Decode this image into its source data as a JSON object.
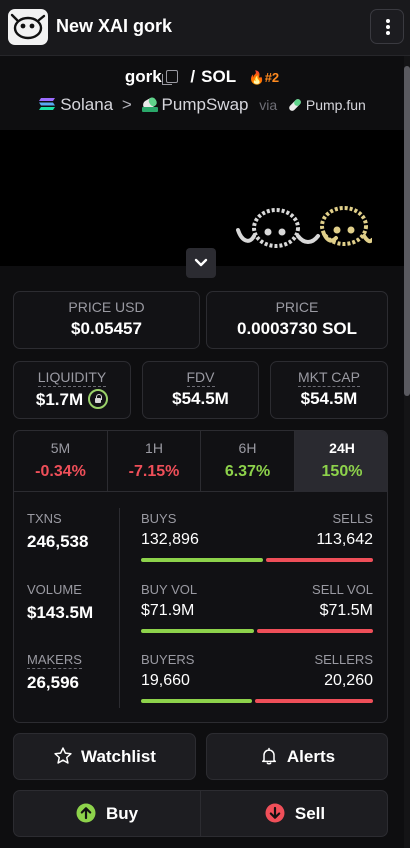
{
  "header": {
    "title": "New XAI gork",
    "logo_icon": "gork-face-icon",
    "menu_icon": "more-vertical-icon"
  },
  "pair": {
    "base": "gork",
    "separator": "/",
    "quote": "SOL",
    "rank": "#2"
  },
  "breadcrumb": {
    "chain": "Solana",
    "dex": "PumpSwap",
    "via": "via",
    "source": "Pump.fun"
  },
  "price": {
    "usd_label": "PRICE USD",
    "usd_value": "$0.05457",
    "native_label": "PRICE",
    "native_value": "0.0003730 SOL"
  },
  "metrics": {
    "liquidity_label": "LIQUIDITY",
    "liquidity_value": "$1.7M",
    "fdv_label": "FDV",
    "fdv_value": "$54.5M",
    "mcap_label": "MKT CAP",
    "mcap_value": "$54.5M"
  },
  "timeframes": [
    {
      "label": "5M",
      "change": "-0.34%"
    },
    {
      "label": "1H",
      "change": "-7.15%"
    },
    {
      "label": "6H",
      "change": "6.37%"
    },
    {
      "label": "24H",
      "change": "150%"
    }
  ],
  "selected_timeframe": "24H",
  "stats": {
    "txns_label": "TXNS",
    "txns_value": "246,538",
    "volume_label": "VOLUME",
    "volume_value": "$143.5M",
    "makers_label": "MAKERS",
    "makers_value": "26,596",
    "buys_label": "BUYS",
    "buys_value": "132,896",
    "sells_label": "SELLS",
    "sells_value": "113,642",
    "buy_vol_label": "BUY VOL",
    "buy_vol_value": "$71.9M",
    "sell_vol_label": "SELL VOL",
    "sell_vol_value": "$71.5M",
    "buyers_label": "BUYERS",
    "buyers_value": "19,660",
    "sellers_label": "SELLERS",
    "sellers_value": "20,260"
  },
  "ratios": {
    "buys_share": 0.539,
    "buy_vol_share": 0.501,
    "buyers_share": 0.492
  },
  "actions": {
    "watchlist_label": "Watchlist",
    "alerts_label": "Alerts",
    "buy_label": "Buy",
    "sell_label": "Sell"
  },
  "colors": {
    "positive": "#8dd24b",
    "negative": "#ef4f59",
    "accent": "#ff8a1f"
  }
}
